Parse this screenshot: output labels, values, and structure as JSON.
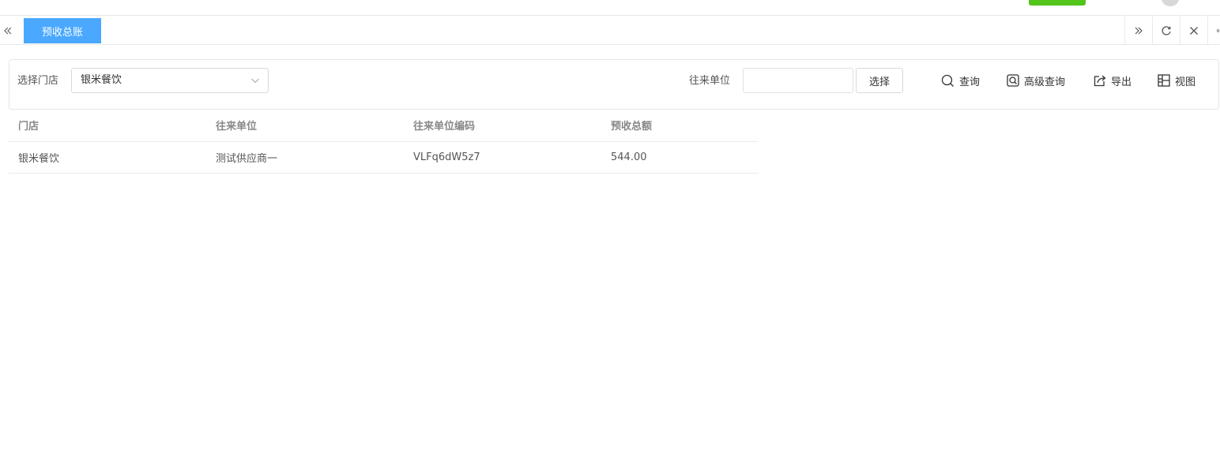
{
  "tab_bar": {
    "active_tab": "预收总账"
  },
  "filters": {
    "store_label": "选择门店",
    "store_value": "银米餐饮",
    "partner_label": "往来单位",
    "partner_value": "",
    "choose_label": "选择"
  },
  "actions": {
    "query": "查询",
    "advanced_query": "高级查询",
    "export": "导出",
    "view": "视图"
  },
  "table": {
    "columns": [
      "门店",
      "往来单位",
      "往来单位编码",
      "预收总额"
    ],
    "rows": [
      [
        "银米餐饮",
        "测试供应商一",
        "VLFq6dW5z7",
        "544.00"
      ]
    ]
  },
  "colors": {
    "active_tab": "#4aa8ff",
    "header_green": "#52c41a"
  }
}
